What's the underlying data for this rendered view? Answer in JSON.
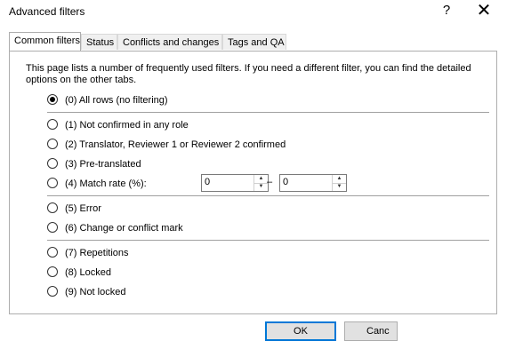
{
  "window": {
    "title": "Advanced filters",
    "help_glyph": "?",
    "close_glyph": "✕"
  },
  "tabs": [
    {
      "label": "Common filters",
      "active": true
    },
    {
      "label": "Status",
      "active": false
    },
    {
      "label": "Conflicts and changes",
      "active": false
    },
    {
      "label": "Tags and QA",
      "active": false
    }
  ],
  "description": "This page lists a number of frequently used filters. If you need a different filter, you can find the detailed options on the other tabs.",
  "options": [
    {
      "label": "(0) All rows (no filtering)",
      "checked": true
    },
    {
      "label": "(1) Not confirmed in any role",
      "checked": false
    },
    {
      "label": "(2) Translator, Reviewer 1 or Reviewer 2 confirmed",
      "checked": false
    },
    {
      "label": "(3) Pre-translated",
      "checked": false
    },
    {
      "label": "(4) Match rate (%):",
      "checked": false
    },
    {
      "label": "(5) Error",
      "checked": false
    },
    {
      "label": "(6) Change or conflict mark",
      "checked": false
    },
    {
      "label": "(7) Repetitions",
      "checked": false
    },
    {
      "label": "(8) Locked",
      "checked": false
    },
    {
      "label": "(9) Not locked",
      "checked": false
    }
  ],
  "match_rate": {
    "from": "0",
    "to": "0",
    "separator": "–"
  },
  "buttons": {
    "ok": "OK",
    "cancel": "Canc"
  }
}
